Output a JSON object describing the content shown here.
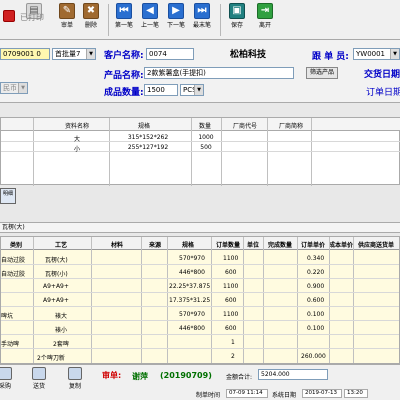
{
  "toolbar": {
    "items": [
      {
        "name": "stop-button",
        "label": "",
        "icon": "stop-icon"
      },
      {
        "name": "print-button",
        "label": "已打印",
        "icon": "printer-icon"
      },
      {
        "name": "review-button",
        "label": "审单",
        "icon": "review-icon"
      },
      {
        "name": "delete-button",
        "label": "删除",
        "icon": "delete-icon"
      },
      {
        "name": "first-button",
        "label": "第一笔",
        "icon": "first-arrow-icon"
      },
      {
        "name": "prev-button",
        "label": "上一笔",
        "icon": "prev-arrow-icon"
      },
      {
        "name": "next-button",
        "label": "下一笔",
        "icon": "next-arrow-icon"
      },
      {
        "name": "last-button",
        "label": "最末笔",
        "icon": "last-arrow-icon"
      },
      {
        "name": "save-button",
        "label": "保存",
        "icon": "save-icon"
      },
      {
        "name": "exit-button",
        "label": "离开",
        "icon": "exit-icon"
      }
    ],
    "left_edge_label": "改"
  },
  "header": {
    "order_no": "0709001 0",
    "order_type": "首批量7",
    "customer_label": "客户名称:",
    "customer_code": "0074",
    "company_name": "松柏科技",
    "salesman_label": "跟 单 员:",
    "salesman_value": "YW0001",
    "product_label": "产品名称:",
    "product_value": "2款紫薯盒(手提扣)",
    "filter_button": "筛选产品",
    "delivery_label": "交货日期",
    "currency": "民币",
    "qty_label": "成品数量:",
    "qty_value": "1500",
    "unit_value": "PCS",
    "order_date_label": "订单日期"
  },
  "materials": {
    "headers": [
      "资料名称",
      "规格",
      "数量",
      "厂商代号",
      "厂商简称"
    ],
    "rows": [
      {
        "name": "大",
        "spec": "315*152*262",
        "qty": "1000",
        "vendor_code": "",
        "vendor_name": ""
      },
      {
        "name": "小",
        "spec": "255*127*192",
        "qty": "500",
        "vendor_code": "",
        "vendor_name": ""
      }
    ]
  },
  "side_button": "明细",
  "process": {
    "title": "瓦楞(大)",
    "headers": [
      "类别",
      "工艺",
      "材料",
      "来源",
      "规格",
      "订单数量",
      "单位",
      "完成数量",
      "订单单价",
      "成本单价",
      "供应商送货单"
    ],
    "rows": [
      {
        "category": "自动过胶",
        "craft": "瓦楞(大)",
        "material": "",
        "source": "",
        "spec": "570*970",
        "qty": "1100",
        "unit": "",
        "done": "",
        "price": "0.340",
        "cost": "",
        "supplier": ""
      },
      {
        "category": "自动过胶",
        "craft": "瓦楞(小)",
        "material": "",
        "source": "",
        "spec": "446*800",
        "qty": "600",
        "unit": "",
        "done": "",
        "price": "0.220",
        "cost": "",
        "supplier": ""
      },
      {
        "category": "",
        "craft": "A9+A9+",
        "material": "",
        "source": "",
        "spec": "22.25*37.875",
        "qty": "1100",
        "unit": "",
        "done": "",
        "price": "0.900",
        "cost": "",
        "supplier": ""
      },
      {
        "category": "",
        "craft": "A9+A9+",
        "material": "",
        "source": "",
        "spec": "17.375*31.25",
        "qty": "600",
        "unit": "",
        "done": "",
        "price": "0.600",
        "cost": "",
        "supplier": ""
      },
      {
        "category": "啤坑",
        "craft": "裱大",
        "material": "",
        "source": "",
        "spec": "570*970",
        "qty": "1100",
        "unit": "",
        "done": "",
        "price": "0.100",
        "cost": "",
        "supplier": ""
      },
      {
        "category": "",
        "craft": "裱小",
        "material": "",
        "source": "",
        "spec": "446*800",
        "qty": "600",
        "unit": "",
        "done": "",
        "price": "0.100",
        "cost": "",
        "supplier": ""
      },
      {
        "category": "手动啤",
        "craft": "2套啤",
        "material": "",
        "source": "",
        "spec": "",
        "qty": "1",
        "unit": "",
        "done": "",
        "price": "",
        "cost": "",
        "supplier": ""
      },
      {
        "category": "",
        "craft": "2个啤刀新",
        "material": "",
        "source": "",
        "spec": "",
        "qty": "2",
        "unit": "",
        "done": "",
        "price": "260.000",
        "cost": "",
        "supplier": ""
      }
    ]
  },
  "bottom": {
    "buttons": [
      "采购",
      "送货",
      "复制"
    ],
    "review_label": "审单:",
    "reviewer": "谢萍",
    "review_code": "(20190709)",
    "amount_label": "金额合计:",
    "amount_value": "5204.000",
    "made_time_label": "制单时间",
    "made_time_value": "07-09 11:14",
    "sys_date_label": "系统日期",
    "sys_date_value": "2019-07-13",
    "sys_time_value": "13:20"
  }
}
